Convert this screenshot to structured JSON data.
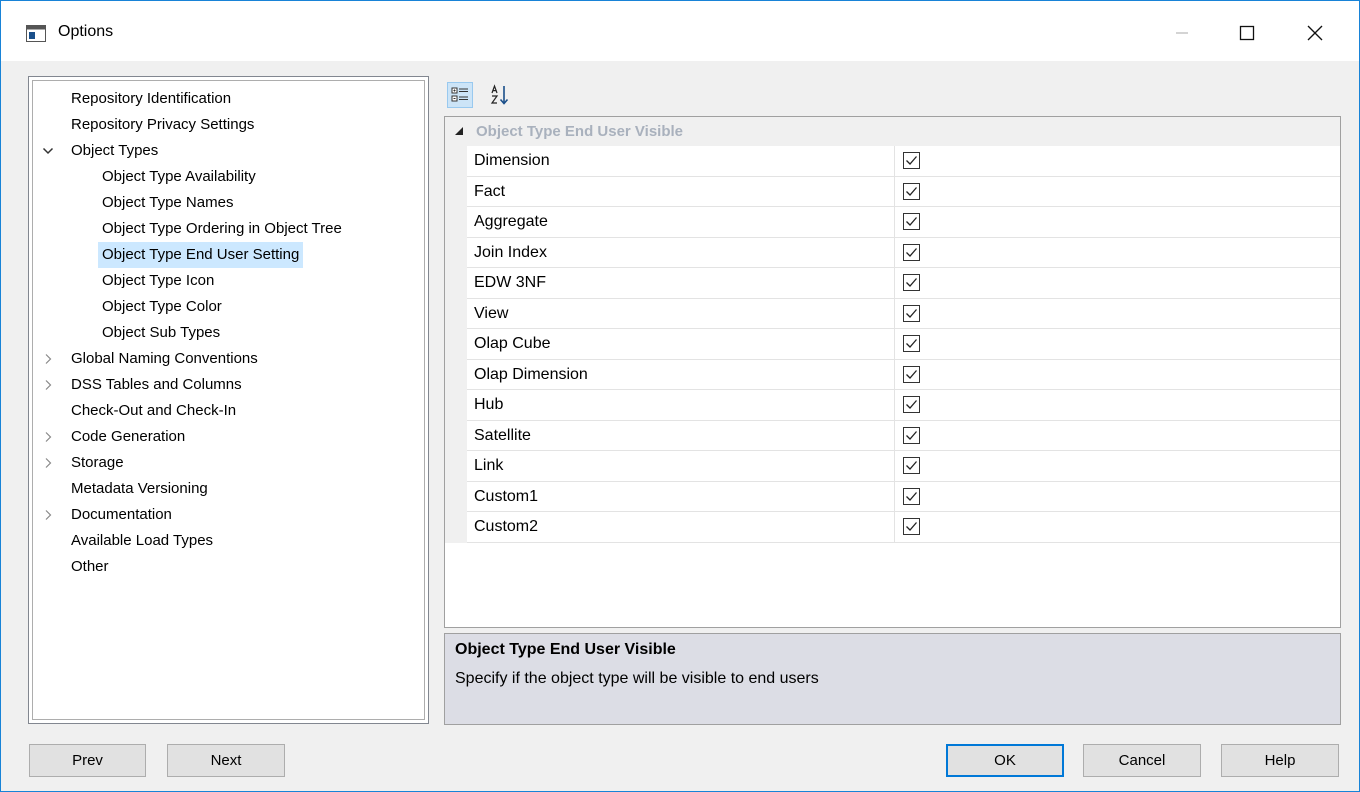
{
  "window": {
    "title": "Options",
    "app_icon": "options-app-icon",
    "controls": {
      "minimize": "minimize-icon",
      "maximize": "maximize-icon",
      "close": "close-icon"
    }
  },
  "tree": {
    "items": [
      {
        "label": "Repository Identification",
        "level": 0,
        "expander": "none"
      },
      {
        "label": "Repository Privacy Settings",
        "level": 0,
        "expander": "none"
      },
      {
        "label": "Object Types",
        "level": 0,
        "expander": "expanded"
      },
      {
        "label": "Object Type Availability",
        "level": 1,
        "expander": "none"
      },
      {
        "label": "Object Type Names",
        "level": 1,
        "expander": "none"
      },
      {
        "label": "Object Type Ordering in Object Tree",
        "level": 1,
        "expander": "none"
      },
      {
        "label": "Object Type End User Setting",
        "level": 1,
        "expander": "none",
        "selected": true
      },
      {
        "label": "Object Type Icon",
        "level": 1,
        "expander": "none"
      },
      {
        "label": "Object Type Color",
        "level": 1,
        "expander": "none"
      },
      {
        "label": "Object Sub Types",
        "level": 1,
        "expander": "none"
      },
      {
        "label": "Global Naming Conventions",
        "level": 0,
        "expander": "collapsed"
      },
      {
        "label": "DSS Tables and Columns",
        "level": 0,
        "expander": "collapsed"
      },
      {
        "label": "Check-Out and Check-In",
        "level": 0,
        "expander": "none"
      },
      {
        "label": "Code Generation",
        "level": 0,
        "expander": "collapsed"
      },
      {
        "label": "Storage",
        "level": 0,
        "expander": "collapsed"
      },
      {
        "label": "Metadata Versioning",
        "level": 0,
        "expander": "none"
      },
      {
        "label": "Documentation",
        "level": 0,
        "expander": "collapsed"
      },
      {
        "label": "Available Load Types",
        "level": 0,
        "expander": "none"
      },
      {
        "label": "Other",
        "level": 0,
        "expander": "none"
      }
    ]
  },
  "toolbar": {
    "categorized": {
      "icon": "categorized-view-icon",
      "active": true
    },
    "alphabetical": {
      "icon": "sort-alphabetical-icon",
      "active": false
    }
  },
  "grid": {
    "category": "Object Type End User Visible",
    "rows": [
      {
        "name": "Dimension",
        "checked": true
      },
      {
        "name": "Fact",
        "checked": true
      },
      {
        "name": "Aggregate",
        "checked": true
      },
      {
        "name": "Join Index",
        "checked": true
      },
      {
        "name": "EDW 3NF",
        "checked": true
      },
      {
        "name": "View",
        "checked": true
      },
      {
        "name": "Olap Cube",
        "checked": true
      },
      {
        "name": "Olap Dimension",
        "checked": true
      },
      {
        "name": "Hub",
        "checked": true
      },
      {
        "name": "Satellite",
        "checked": true
      },
      {
        "name": "Link",
        "checked": true
      },
      {
        "name": "Custom1",
        "checked": true
      },
      {
        "name": "Custom2",
        "checked": true
      }
    ]
  },
  "description": {
    "title": "Object Type End User Visible",
    "text": "Specify if the object type will be visible to end users"
  },
  "buttons": {
    "prev": "Prev",
    "next": "Next",
    "ok": "OK",
    "cancel": "Cancel",
    "help": "Help"
  },
  "colors": {
    "selection": "#cce8ff",
    "accent": "#0078d7",
    "window_border": "#1883d7",
    "description_bg": "#dcdde5",
    "category_text": "#a9b1bd"
  }
}
